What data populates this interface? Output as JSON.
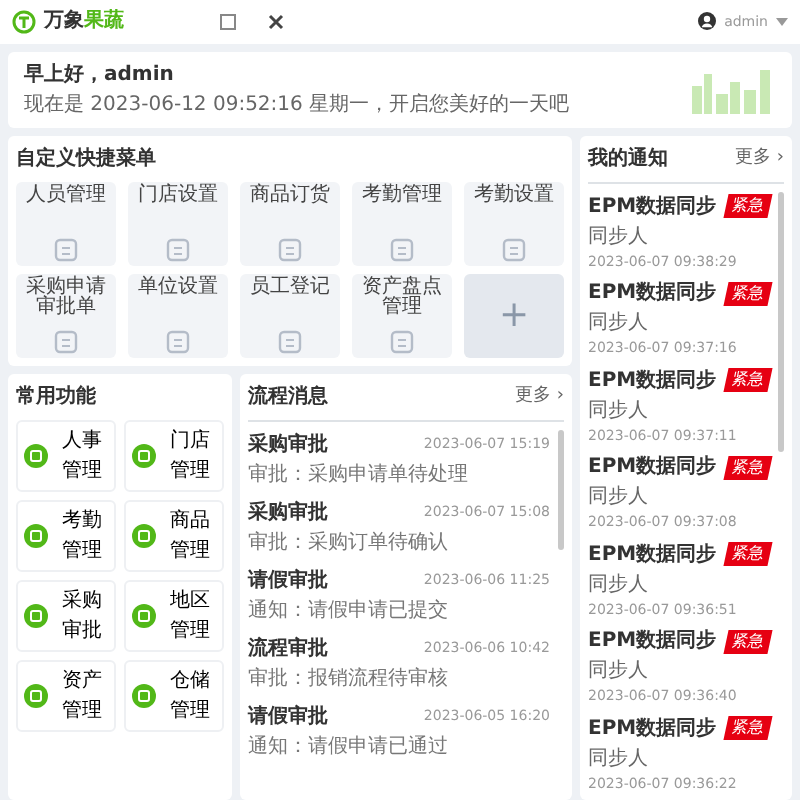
{
  "header": {
    "logo": {
      "text_1": "万象",
      "text_2": "果蔬"
    },
    "user": "admin"
  },
  "greeting": {
    "title": "早上好，admin",
    "subtitle": "现在是 2023-06-12 09:52:16 星期一，开启您美好的一天吧"
  },
  "quick_menu": {
    "title": "自定义快捷菜单",
    "items": [
      "人员管理",
      "门店设置",
      "商品订货",
      "考勤管理",
      "考勤设置",
      "采购申请审批单",
      "单位设置",
      "员工登记",
      "资产盘点管理"
    ],
    "add": "+"
  },
  "common": {
    "title": "常用功能",
    "items": [
      "人事管理",
      "门店管理",
      "考勤管理",
      "商品管理",
      "采购审批",
      "地区管理",
      "资产管理",
      "仓储管理"
    ]
  },
  "process": {
    "title": "流程消息",
    "more": "更多 ›",
    "items": [
      {
        "title": "采购审批",
        "time": "2023-06-07 15:19",
        "detail": "审批：采购申请单待处理"
      },
      {
        "title": "采购审批",
        "time": "2023-06-07 15:08",
        "detail": "审批：采购订单待确认"
      },
      {
        "title": "请假审批",
        "time": "2023-06-06 11:25",
        "detail": "通知：请假申请已提交"
      },
      {
        "title": "流程审批",
        "time": "2023-06-06 10:42",
        "detail": "审批：报销流程待审核"
      },
      {
        "title": "请假审批",
        "time": "2023-06-05 16:20",
        "detail": "通知：请假申请已通过"
      }
    ]
  },
  "notices": {
    "title": "我的通知",
    "more": "更多 ›",
    "items": [
      {
        "title": "EPM数据同步",
        "body": "同步人",
        "time": "2023-06-07 09:38:29",
        "tag": "紧急"
      },
      {
        "title": "EPM数据同步",
        "body": "同步人",
        "time": "2023-06-07 09:37:16",
        "tag": "紧急"
      },
      {
        "title": "EPM数据同步",
        "body": "同步人",
        "time": "2023-06-07 09:37:11",
        "tag": "紧急"
      },
      {
        "title": "EPM数据同步",
        "body": "同步人",
        "time": "2023-06-07 09:37:08",
        "tag": "紧急"
      },
      {
        "title": "EPM数据同步",
        "body": "同步人",
        "time": "2023-06-07 09:36:51",
        "tag": "紧急"
      },
      {
        "title": "EPM数据同步",
        "body": "同步人",
        "time": "2023-06-07 09:36:40",
        "tag": "紧急"
      },
      {
        "title": "EPM数据同步",
        "body": "同步人",
        "time": "2023-06-07 09:36:22",
        "tag": "紧急"
      }
    ]
  }
}
